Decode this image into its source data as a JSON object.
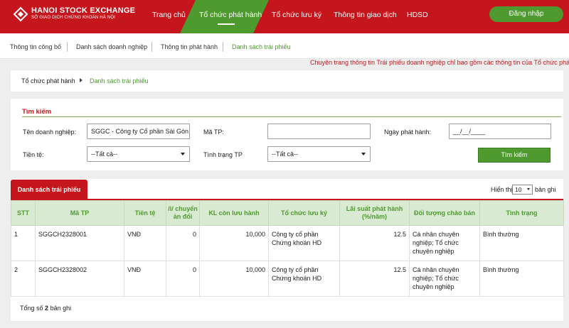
{
  "header": {
    "logo_title": "HANOI STOCK EXCHANGE",
    "logo_subtitle": "SỞ GIAO DỊCH CHỨNG KHOÁN HÀ NỘI",
    "nav": [
      "Trang chủ",
      "Tổ chức phát hành",
      "Tổ chức lưu ký",
      "Thông tin giao dịch",
      "HDSD"
    ],
    "active_nav": "Tổ chức phát hành",
    "login_label": "Đăng nhập",
    "brand_color": "#c4161c",
    "accent_color": "#4e9a2f"
  },
  "subnav": {
    "items": [
      "Thông tin công bố",
      "Danh sách doanh nghiệp",
      "Thông tin phát hành",
      "Danh sách trái phiếu"
    ],
    "active": "Danh sách trái phiếu"
  },
  "marquee": "Chuyên trang thông tin Trái phiếu doanh nghiệp chỉ bao gồm các thông tin của Tổ chức phát hà",
  "breadcrumb": {
    "parent": "Tổ chức phát hành",
    "current": "Danh sách trái phiếu"
  },
  "search": {
    "title": "Tìm kiếm",
    "company_label": "Tên doanh nghiệp:",
    "company_value": "SGGC - Công ty Cổ phần Sài Gòn",
    "code_label": "Mã TP:",
    "code_value": "",
    "date_label": "Ngày phát hành:",
    "date_value": "__/__/____",
    "currency_label": "Tiền tệ:",
    "currency_value": "--Tất cả--",
    "status_label": "Tình trạng TP",
    "status_value": "--Tất cả--",
    "search_button": "Tìm kiếm"
  },
  "table": {
    "tab_label": "Danh sách trái phiếu",
    "show_label": "Hiển thị",
    "page_size": "10",
    "records_label": "bản ghi",
    "columns": [
      "STT",
      "Mã TP",
      "Tiền tệ",
      "/i/ chuyển ản đổi",
      "KL còn lưu hành",
      "Tổ chức lưu ký",
      "Lãi suất phát hành (%/năm)",
      "Đối tượng chào bán",
      "Tình trạng"
    ],
    "rows": [
      [
        "1",
        "SGGCH2328001",
        "VNĐ",
        "0",
        "10,000",
        "Công ty cổ phần Chứng khoán HD",
        "12.5",
        "Cá nhân chuyên nghiệp; Tổ chức chuyên nghiệp",
        "Bình thường"
      ],
      [
        "2",
        "SGGCH2328002",
        "VNĐ",
        "0",
        "10,000",
        "Công ty cổ phần Chứng khoán HD",
        "12.5",
        "Cá nhân chuyên nghiệp; Tổ chức chuyên nghiệp",
        "Bình thường"
      ]
    ],
    "total_prefix": "Tổng số",
    "total_count": "2",
    "total_suffix": "bản ghi"
  }
}
